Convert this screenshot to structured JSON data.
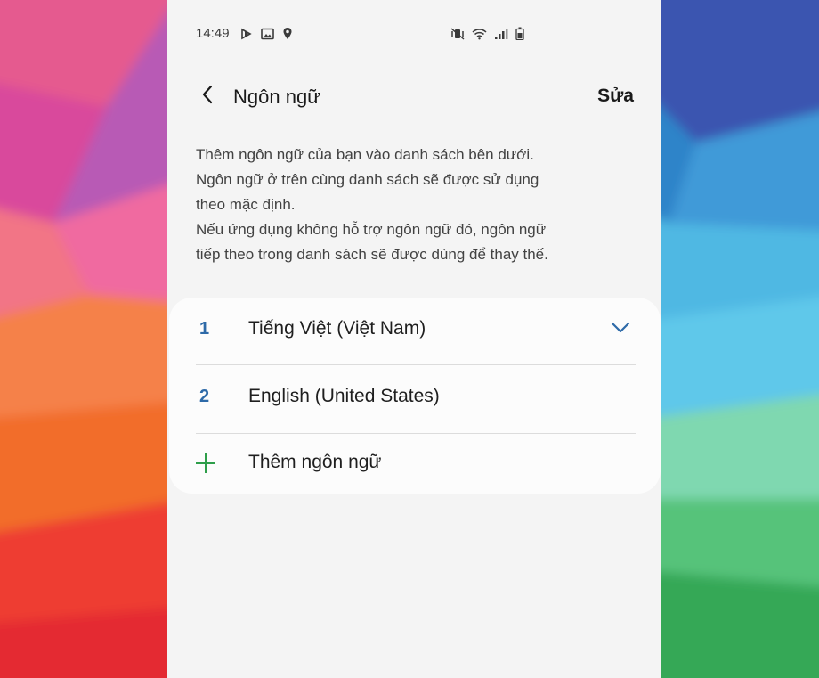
{
  "status_bar": {
    "time": "14:49",
    "left_icons": [
      "media-play-icon",
      "image-icon",
      "location-pin-icon"
    ],
    "right_icons": [
      "mute-vibrate-icon",
      "wifi-icon",
      "cellular-signal-icon",
      "battery-icon"
    ]
  },
  "app_bar": {
    "title": "Ngôn ngữ",
    "edit_label": "Sửa",
    "back_icon": "back-chevron-icon"
  },
  "description": {
    "line1": "Thêm ngôn ngữ của bạn vào danh sách bên dưới.",
    "line2": "Ngôn ngữ ở trên cùng danh sách sẽ được sử dụng",
    "line3": "theo mặc định.",
    "line4": "Nếu ứng dụng không hỗ trợ ngôn ngữ đó, ngôn ngữ",
    "line5": "tiếp theo trong danh sách sẽ được dùng để thay thế."
  },
  "languages": [
    {
      "index": "1",
      "label": "Tiếng Việt (Việt Nam)",
      "selected": true
    },
    {
      "index": "2",
      "label": "English (United States)",
      "selected": false
    }
  ],
  "add_language": {
    "label": "Thêm ngôn ngữ",
    "icon": "plus-icon"
  },
  "colors": {
    "accent_blue": "#2e6aa8",
    "add_green": "#2e9e4a",
    "screen_background": "#f4f4f4",
    "card_background": "#fcfcfc"
  }
}
